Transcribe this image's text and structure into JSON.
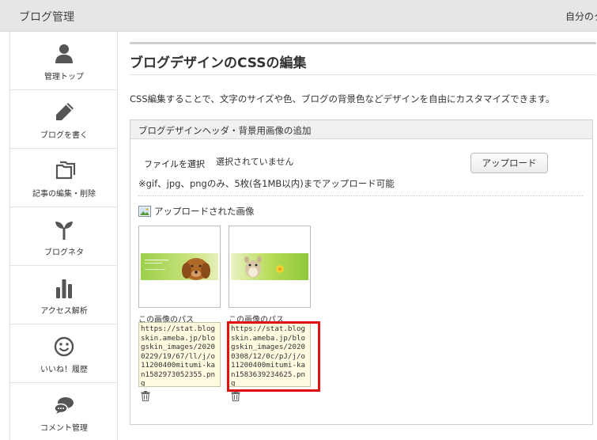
{
  "topbar": {
    "title": "ブログ管理",
    "right_text": "自分のク"
  },
  "sidebar": {
    "items": [
      {
        "label": "管理トップ",
        "icon": "person-icon"
      },
      {
        "label": "ブログを書く",
        "icon": "pencil-icon"
      },
      {
        "label": "記事の編集・削除",
        "icon": "copy-icon"
      },
      {
        "label": "ブログネタ",
        "icon": "sprout-icon"
      },
      {
        "label": "アクセス解析",
        "icon": "bar-chart-icon"
      },
      {
        "label": "いいね！履歴",
        "icon": "smiley-icon"
      },
      {
        "label": "コメント管理",
        "icon": "comment-icon"
      }
    ]
  },
  "main": {
    "page_title": "ブログデザインのCSSの編集",
    "description": "CSS編集することで、文字のサイズや色、ブログの背景色などデザインを自由にカスタマイズできます。",
    "panel": {
      "header": "ブログデザインヘッダ・背景用画像の追加",
      "file_button": "ファイルを選択",
      "file_status": "選択されていません",
      "upload_button": "アップロード",
      "note": "※gif、jpg、pngのみ、5枚(各1MB以内)までアップロード可能",
      "uploaded_label": "アップロードされた画像",
      "images": [
        {
          "path_label": "この画像のパス",
          "path": "https://stat.blogskin.ameba.jp/blogskin_images/20200229/19/67/ll/j/o11200400mitumi-kan1582973052355.png"
        },
        {
          "path_label": "この画像のパス",
          "path": "https://stat.blogskin.ameba.jp/blogskin_images/20200308/12/0c/pJ/j/o11200400mitumi-kan1583639234625.png"
        }
      ]
    }
  },
  "colors": {
    "highlight": "#e01010",
    "path_bg": "#fffbe0",
    "topbar_bg": "#e6e6e6"
  }
}
